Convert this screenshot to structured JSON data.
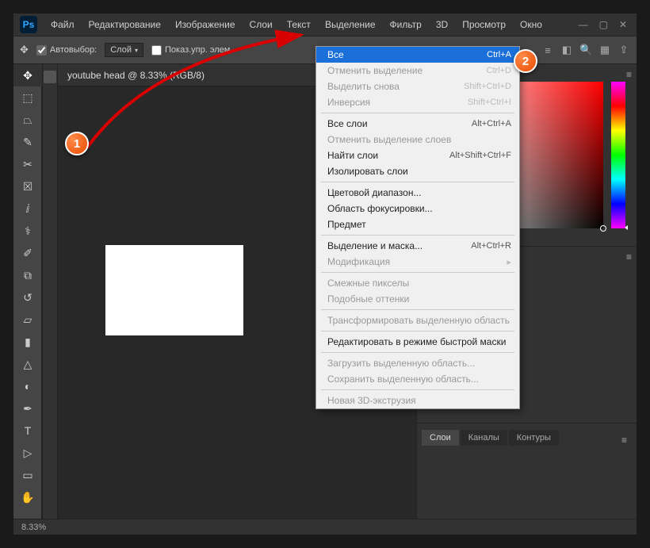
{
  "app_logo": "Ps",
  "menubar": [
    "Файл",
    "Редактирование",
    "Изображение",
    "Слои",
    "Текст",
    "Выделение",
    "Фильтр",
    "3D",
    "Просмотр",
    "Окно"
  ],
  "sysbtns": {
    "min": "—",
    "max": "▢",
    "close": "✕"
  },
  "optbar": {
    "autoselect": "Автовыбор:",
    "layer_select": "Слой",
    "show_controls": "Показ.упр. элем."
  },
  "document_tab": "youtube head @ 8.33% (RGB/8)",
  "zoom": "8.33%",
  "layers_tabs": [
    "Слои",
    "Каналы",
    "Контуры"
  ],
  "dropdown": {
    "groups": [
      [
        {
          "label": "Все",
          "shortcut": "Ctrl+A",
          "state": "highlight"
        },
        {
          "label": "Отменить выделение",
          "shortcut": "Ctrl+D",
          "state": "disabled"
        },
        {
          "label": "Выделить снова",
          "shortcut": "Shift+Ctrl+D",
          "state": "disabled"
        },
        {
          "label": "Инверсия",
          "shortcut": "Shift+Ctrl+I",
          "state": "disabled"
        }
      ],
      [
        {
          "label": "Все слои",
          "shortcut": "Alt+Ctrl+A",
          "state": ""
        },
        {
          "label": "Отменить выделение слоев",
          "shortcut": "",
          "state": "disabled"
        },
        {
          "label": "Найти слои",
          "shortcut": "Alt+Shift+Ctrl+F",
          "state": ""
        },
        {
          "label": "Изолировать слои",
          "shortcut": "",
          "state": ""
        }
      ],
      [
        {
          "label": "Цветовой диапазон...",
          "shortcut": "",
          "state": ""
        },
        {
          "label": "Область фокусировки...",
          "shortcut": "",
          "state": ""
        },
        {
          "label": "Предмет",
          "shortcut": "",
          "state": ""
        }
      ],
      [
        {
          "label": "Выделение и маска...",
          "shortcut": "Alt+Ctrl+R",
          "state": ""
        },
        {
          "label": "Модификация",
          "shortcut": "",
          "state": "disabled",
          "submenu": true
        }
      ],
      [
        {
          "label": "Смежные пикселы",
          "shortcut": "",
          "state": "disabled"
        },
        {
          "label": "Подобные оттенки",
          "shortcut": "",
          "state": "disabled"
        }
      ],
      [
        {
          "label": "Трансформировать выделенную область",
          "shortcut": "",
          "state": "disabled"
        }
      ],
      [
        {
          "label": "Редактировать в режиме быстрой маски",
          "shortcut": "",
          "state": ""
        }
      ],
      [
        {
          "label": "Загрузить выделенную область...",
          "shortcut": "",
          "state": "disabled"
        },
        {
          "label": "Сохранить выделенную область...",
          "shortcut": "",
          "state": "disabled"
        }
      ],
      [
        {
          "label": "Новая 3D-экструзия",
          "shortcut": "",
          "state": "disabled"
        }
      ]
    ]
  },
  "badges": {
    "one": "1",
    "two": "2"
  },
  "tools": [
    {
      "name": "move-tool",
      "glyph": "✥",
      "active": true
    },
    {
      "name": "marquee-tool",
      "glyph": "⬚"
    },
    {
      "name": "lasso-tool",
      "glyph": "⏢"
    },
    {
      "name": "quick-select-tool",
      "glyph": "✎"
    },
    {
      "name": "crop-tool",
      "glyph": "✂"
    },
    {
      "name": "frame-tool",
      "glyph": "☒"
    },
    {
      "name": "eyedropper-tool",
      "glyph": "ⅈ"
    },
    {
      "name": "healing-tool",
      "glyph": "⚕"
    },
    {
      "name": "brush-tool",
      "glyph": "✐"
    },
    {
      "name": "stamp-tool",
      "glyph": "⧉"
    },
    {
      "name": "history-brush-tool",
      "glyph": "↺"
    },
    {
      "name": "eraser-tool",
      "glyph": "▱"
    },
    {
      "name": "gradient-tool",
      "glyph": "▮"
    },
    {
      "name": "blur-tool",
      "glyph": "△"
    },
    {
      "name": "dodge-tool",
      "glyph": "◐"
    },
    {
      "name": "pen-tool",
      "glyph": "✒"
    },
    {
      "name": "type-tool",
      "glyph": "T"
    },
    {
      "name": "path-tool",
      "glyph": "▷"
    },
    {
      "name": "shape-tool",
      "glyph": "▭"
    },
    {
      "name": "hand-tool",
      "glyph": "✋"
    }
  ]
}
